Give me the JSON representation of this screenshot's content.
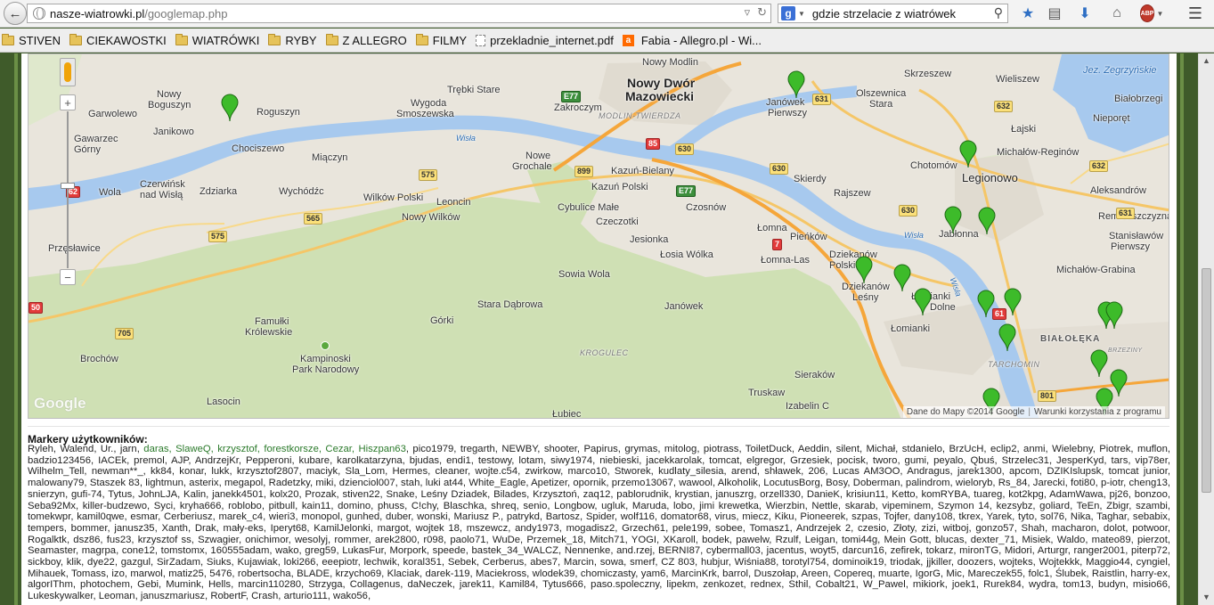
{
  "browser": {
    "url_host": "nasze-wiatrowki.pl",
    "url_path": "/googlemap.php",
    "search_query": "gdzie strzelacie z wiatrówek",
    "search_engine_letter": "g",
    "abp_label": "ABP"
  },
  "bookmarks": [
    {
      "label": "STIVEN",
      "icon": "folder-icon"
    },
    {
      "label": "CIEKAWOSTKI",
      "icon": "folder-icon"
    },
    {
      "label": "WIATRÓWKI",
      "icon": "folder-icon"
    },
    {
      "label": "RYBY",
      "icon": "folder-icon"
    },
    {
      "label": "Z ALLEGRO",
      "icon": "folder-icon"
    },
    {
      "label": "FILMY",
      "icon": "folder-icon"
    },
    {
      "label": "przekladnie_internet.pdf",
      "icon": "page-icon"
    },
    {
      "label": "Fabia - Allegro.pl - Wi...",
      "icon": "allegro-icon"
    }
  ],
  "map": {
    "places": {
      "nowy_modlin": "Nowy Modlin",
      "nowy_dwor": "Nowy Dwór",
      "mazowiecki": "Mazowiecki",
      "nowy_boguszyn": "Nowy",
      "nowy_boguszyn2": "Boguszyn",
      "roguszyn": "Roguszyn",
      "garwolewo": "Garwolewo",
      "janikowo": "Janikowo",
      "trebki_stare": "Trębki Stare",
      "wygoda": "Wygoda",
      "smoszewska": "Smoszewska",
      "zakroczym": "Zakroczym",
      "modlin_twierdza": "MODLIN-TWIERDZA",
      "janowek_pierwszy": "Janówek",
      "janowek_pierwszy2": "Pierwszy",
      "skrzeszew": "Skrzeszew",
      "olszewnica": "Olszewnica",
      "olszewnica2": "Stara",
      "wieliszew": "Wieliszew",
      "jez_zegrzynskie": "Jez. Zegrzyńskie",
      "bialobrzegi": "Białobrzegi",
      "gawarzec": "Gawarzec",
      "gawarzec2": "Górny",
      "chociszewo": "Chociszewo",
      "miaczyn": "Miączyn",
      "nowe_grochale": "Nowe",
      "nowe_grochale2": "Grochale",
      "kazun_bielany": "Kazuń-Bielany",
      "kazun_polski": "Kazuń Polski",
      "chotomow": "Chotomów",
      "michalow_reginow": "Michałów-Reginów",
      "lajski": "Łajski",
      "nieporet": "Nieporęt",
      "legionowo": "Legionowo",
      "skierdy": "Skierdy",
      "wola": "Wola",
      "czerwinsk": "Czerwińsk",
      "czerwinsk2": "nad Wisłą",
      "zdziarka": "Zdziarka",
      "wychodzc": "Wychódźc",
      "wilkow_polski": "Wilków Polski",
      "leoncin": "Leoncin",
      "cybulice_male": "Cybulice Małe",
      "czeczotki": "Czeczotki",
      "czosnow": "Czosnów",
      "rajszew": "Rajszew",
      "aleksandrow": "Aleksandrów",
      "jablonna": "Jabłonna",
      "rembelszczyzna": "Rembelszczyzna",
      "przeslawice": "Przęsławice",
      "nowy_wilkow": "Nowy Wilków",
      "jesionka": "Jesionka",
      "lomna": "Łomna",
      "pienkow": "Pieńków",
      "stanislawow": "Stanisławów",
      "stanislawow2": "Pierwszy",
      "losia_wolka": "Łosia Wólka",
      "lomna_las": "Łomna-Las",
      "dziekanow_polski": "Dziekanów",
      "dziekanow_polski2": "Polski",
      "michalow_grabina": "Michałów-Grabina",
      "sowia_wola": "Sowia Wola",
      "dziekanow_lesny": "Dziekanów",
      "dziekanow_lesny2": "Leśny",
      "lomianki_dolne": "Łomianki",
      "lomianki_dolne2": "Dolne",
      "stara_dabrowa": "Stara Dąbrowa",
      "janowek": "Janówek",
      "famulki": "Famułki",
      "famulki2": "Królewskie",
      "gorki": "Górki",
      "lomianki": "Łomianki",
      "bialoleka": "BIAŁOŁĘKA",
      "brochow": "Brochów",
      "kampinoski": "Kampinoski",
      "kampinoski2": "Park Narodowy",
      "krogulec": "KROGULEC",
      "tarchomin": "TARCHOMIN",
      "brzeziny": "BRZEZINY",
      "sierakow": "Sieraków",
      "lasocin": "Lasocin",
      "truskaw": "Truskaw",
      "izabelin": "Izabelin C",
      "lubiec": "Łubiec",
      "wisla1": "Wisła",
      "wisla2": "Wisła",
      "wisla3": "Wisła"
    },
    "roads": [
      "631",
      "632",
      "632",
      "E77",
      "85",
      "630",
      "630",
      "631",
      "575",
      "899",
      "E77",
      "630",
      "7",
      "565",
      "575",
      "61",
      "705",
      "50",
      "801",
      "62",
      "61"
    ],
    "google_logo": "Google",
    "attribution": "Dane do Mapy ©2014 Google",
    "terms": "Warunki korzystania z programu"
  },
  "markers_heading": "Markery użytkowników:",
  "markers_green": "daras, SlaweQ, krzysztof, forestkorsze, Cezar, Hiszpan63",
  "markers_text": "Ryleh, Walend, Ur., jarn, ",
  "markers_rest": ", pico1979, tregarth, NEWBY, shooter, Papirus, grymas, mitolog, piotrass, ToiletDuck, Aeddin, silent, Michał, stdanielo, BrzUcH, eclip2, anmi, Wielebny, Piotrek, muflon, badzio123456, IACEk, premol, AJP, AndrzejKr, Pepperoni, kubare, karolkatarzyna, bjudas, endi1, testowy, lotam, siwy1974, niebieski, jacekkarolak, tomcat, elgregor, Grzesiek, pocisk, tworo, gumi, peyalo, Qbuś, Strzelec31, JesperKyd, tars, vip78er, Wilhelm_Tell, newman**_, kk84, konar, lukk, krzysztof2807, maciyk, Sla_Lom, Hermes, cleaner, wojte.c54, zwirkow, marco10, Stworek, kudlaty_silesia, arend, shławek, 206, Lucas AM3OO, Andragus, jarek1300, apcom, DZIKIslupsk, tomcat junior, malowany79, Staszek 83, lightmun, asterix, megapol, Radetzky, miki, dzienciol007, stah, luki at44, White_Eagle, Apetizer, opornik, przemo13067, wawool, Alkoholik, LocutusBorg, Bosy, Doberman, palindrom, wieloryb, Rs_84, Jarecki, foti80, p-iotr, cheng13, snierzyn, gufi-74, Tytus, JohnLJA, Kalin, janekk4501, kolx20, Prozak, stiven22, Snake, Leśny Dziadek, Bilades, Krzysztoń, zaq12, pablorudnik, krystian, januszrg, orzell330, DanieK, krisiun11, Ketto, komRYBA, tuareg, kot2kpg, AdamWawa, pj26, bonzoo, Seba92Mx, killer-budzewo, Syci, kryha666, roblobo, pitbull, kain11, domino, phuss, C!chy, Blaschka, shreq, senio, Longbow, ugluk, Maruda, lobo, jimi krewetka, Wierzbin, Nettle, skarab, vipeminem, Szymon 14, kezsybz, goliard, TeEn, Zbigr, szambi, tomekwpr, kamil0qwe, esmar, Cerberiusz, marek_c4, wieri3, monopol, gunhed, duber, wonski, Mariusz P., patrykd, Bartosz, Spider, wolf116, domator68, virus, miecz, Kiku, Pioneerek, szpas, Tojfer, dany108, tkrex, Yarek, tyto, sol76, Nika, Taghar, sebabix, tempers, bommer, janusz35, Xanth, Drak, mały-eks, Iperyt68, KamilJelonki, margot, wojtek 18, mszewcz, andy1973, mogadisz2, Grzech61, pele199, sobee, Tomasz1, Andrzejek 2, czesio, Złoty, zizi, witboj, gonzo57, Shah, macharon, dolot, potwoor, Rogalktk, dsz86, fus23, krzysztof ss, Szwagier, onichimor, wesolyj, rommer, arek2800, r098, paolo71, WuDe, Przemek_18, Mitch71, YOGI, XKaroll, bodek, pawelw, Rzulf, Leigan, tomi44g, Mein Gott, blucas, dexter_71, Misiek, Waldo, mateo89, pierzot, Seamaster, magrpa, cone12, tomstomx, 160555adam, wako, greg59, LukasFur, Morpork, speede, bastek_34_WALCZ, Nennenke, and.rzej, BERNI87, cybermall03, jacentus, woyt5, darcun16, zefirek, tokarz, mironTG, Midori, Arturgr, ranger2001, piterp72, sickboy, klik, dye22, gazgul, SirZadam, Siuks, Kujawiak, loki266, eeepiotr, lechwik, koral351, Sebek, Cerberus, abes7, Marcin, sowa, smerf, CZ 803, hubjur, Wiśnia88, torotyl754, dominoik19, triodak, jjkiller, doozers, wojteks, Wojtekkk, Maggio44, cyngiel, Mihauek, Tomass, izo, marwol, matiz25, 5476, robertsocha, BLADE, krzycho69, Klaciak, darek-119, Maciekross, wlodek39, chomiczasty, yam6, MarcinKrk, barrol, Duszołap, Areen, Copereq, muarte, IgorG, Mic, Mareczek55, folc1, Ślubek, Raistlin, harry-ex, algorIThm, photochem, Gebi, Mumink, Hells, marcin110280, Strzyga, Collagenus, daNeczek, jarek11, Kamil84, Tytus666, paso.spoleczny, lipekm, zenkozet, rednex, Sthil, Cobalt21, W_Pawel, mikiork, joek1, Rurek84, wydra, tom13, budyn, misio66, Lukeskywalker, Leoman, januszmariusz, RobertF, Crash, arturio111, wako56,"
}
